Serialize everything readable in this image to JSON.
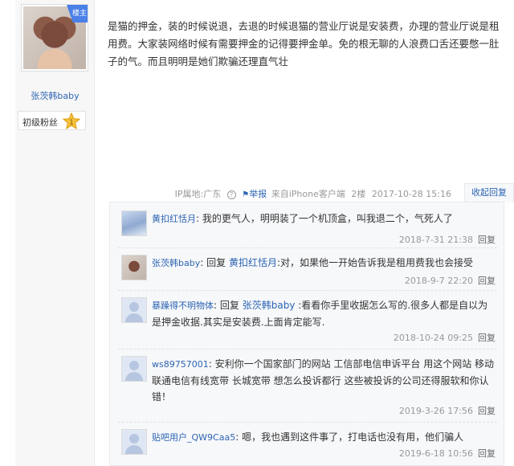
{
  "author": {
    "badge": "楼主",
    "name": "张茨韩baby",
    "level_label": "初级粉丝",
    "level_num": "1"
  },
  "post": {
    "content": "是猫的押金，装的时候说退，去退的时候退猫的营业厅说是安装费，办理的营业厅说是租用费。大家装网络时候有需要押金的记得要押金单。免的根无聊的人浪费口舌还要憋一肚子的气。而且明明是她们欺骗还理直气壮",
    "ip_label": "IP属地:广东",
    "ip_help": "?",
    "report": "举报",
    "source": "来自iPhone客户端",
    "floor": "2楼",
    "time": "2017-10-28 15:16",
    "collapse_reply": "收起回复"
  },
  "replies": [
    {
      "user": "黄扣红恬月",
      "sep": ":",
      "reply_prefix": "",
      "reply_to": "",
      "text": "我的更气人，明明装了一个机顶盒，叫我退二个，气死人了",
      "time": "2018-7-31 21:38",
      "reply_btn": "回复",
      "avatar": "anime-avatar"
    },
    {
      "user": "张茨韩baby",
      "sep": ":",
      "reply_prefix": "回复",
      "reply_to": "黄扣红恬月",
      "text": ":对，如果他一开始告诉我是租用费我也会接受",
      "time": "2018-9-7 22:20",
      "reply_btn": "回复",
      "avatar": "dog-avatar"
    },
    {
      "user": "暴躁得不明物体",
      "sep": ":",
      "reply_prefix": "回复",
      "reply_to": "张茨韩baby",
      "text": ":看看你手里收据怎么写的.很多人都是自以为是押金收据.其实是安装费.上面肯定能写.",
      "time": "2018-10-24 09:25",
      "reply_btn": "回复",
      "avatar": "default-avatar"
    },
    {
      "user": "ws89757001",
      "sep": ":",
      "reply_prefix": "",
      "reply_to": "",
      "text": "安利你一个国家部门的网站 工信部电信申诉平台 用这个网站 移动联通电信有线宽带 长城宽带 想怎么投诉都行 这些被投诉的公司还得服软和你认错！",
      "time": "2019-3-26 17:56",
      "reply_btn": "回复",
      "avatar": "default-avatar"
    },
    {
      "user": "贴吧用户_QW9Caa5",
      "sep": ":",
      "reply_prefix": "",
      "reply_to": "",
      "text": "嗯，我也遇到这件事了，打电话也没有用，他们骗人",
      "time": "2019-6-18 10:56",
      "reply_btn": "回复",
      "avatar": "default-avatar"
    }
  ],
  "colors": {
    "link": "#2d64b3",
    "muted": "#999999",
    "badge": "#4a80e8",
    "panel": "#f7f8fa"
  }
}
